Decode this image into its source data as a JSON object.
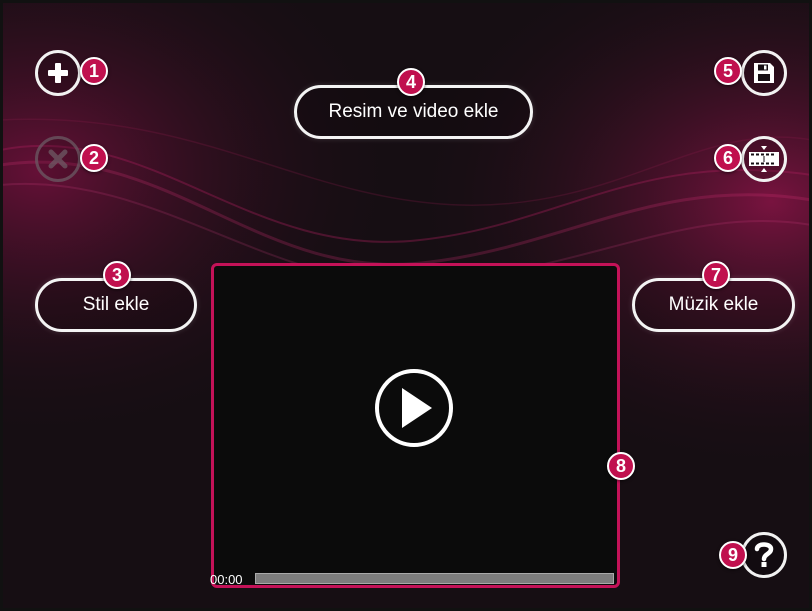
{
  "buttons": {
    "add_media": "Resim ve video ekle",
    "add_style": "Stil ekle",
    "add_music": "Müzik ekle"
  },
  "icons": {
    "add": "plus-icon",
    "remove": "close-icon",
    "save": "save-icon",
    "edit": "film-icon",
    "play": "play-icon",
    "help": "help-icon"
  },
  "player": {
    "time": "00:00",
    "progress": 0
  },
  "callouts": [
    "1",
    "2",
    "3",
    "4",
    "5",
    "6",
    "7",
    "8",
    "9"
  ],
  "colors": {
    "accent": "#c0104e",
    "player_border": "#c41258",
    "background": "#170f14"
  }
}
